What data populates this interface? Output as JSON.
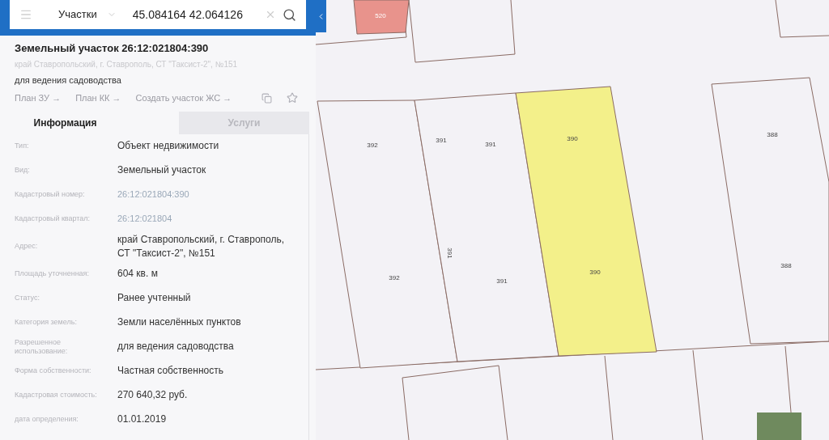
{
  "search": {
    "layer": "Участки",
    "value": "45.084164 42.064126"
  },
  "object": {
    "title": "Земельный участок 26:12:021804:390",
    "address": "край Ставропольский, г. Ставрополь, СТ \"Таксист-2\", №151",
    "purpose": "для ведения садоводства",
    "links": [
      "План ЗУ →",
      "План КК →",
      "Создать участок ЖС →"
    ]
  },
  "tabs": [
    {
      "label": "Информация",
      "selected": true
    },
    {
      "label": "Услуги",
      "selected": false
    }
  ],
  "info_rows": [
    {
      "label": "Тип:",
      "value": "Объект недвижимости",
      "kind": "text"
    },
    {
      "label": "Вид:",
      "value": "Земельный участок",
      "kind": "text"
    },
    {
      "label": "Кадастровый номер:",
      "value": "26:12:021804:390",
      "kind": "link"
    },
    {
      "label": "Кадастровый квартал:",
      "value": "26:12:021804",
      "kind": "link"
    },
    {
      "label": "Адрес:",
      "value": "край Ставропольский, г. Ставрополь, СТ \"Таксист-2\", №151",
      "kind": "text"
    },
    {
      "label": "Площадь уточненная:",
      "value": "604 кв. м",
      "kind": "text"
    },
    {
      "label": "Статус:",
      "value": "Ранее учтенный",
      "kind": "text"
    },
    {
      "label": "Категория земель:",
      "value": "Земли населённых пунктов",
      "kind": "text"
    },
    {
      "label": "Разрешенное использование:",
      "value": "для ведения садоводства",
      "kind": "text"
    },
    {
      "label": "Форма собственности:",
      "value": "Частная собственность",
      "kind": "text"
    },
    {
      "label": "Кадастровая стоимость:",
      "value": "270 640,32 руб.",
      "kind": "text"
    },
    {
      "label": "дата определения:",
      "value": "01.01.2019",
      "kind": "text"
    }
  ],
  "map": {
    "parcels": [
      {
        "kind": "building",
        "labels": [
          "520"
        ]
      },
      {
        "kind": "plot",
        "selected": false,
        "labels": [
          "392",
          "392"
        ]
      },
      {
        "kind": "plot",
        "selected": false,
        "labels": [
          "391",
          "391",
          "391",
          "391"
        ]
      },
      {
        "kind": "plot",
        "selected": true,
        "labels": [
          "390",
          "390"
        ]
      },
      {
        "kind": "plot",
        "selected": false,
        "labels": [
          "388",
          "388"
        ]
      }
    ]
  }
}
